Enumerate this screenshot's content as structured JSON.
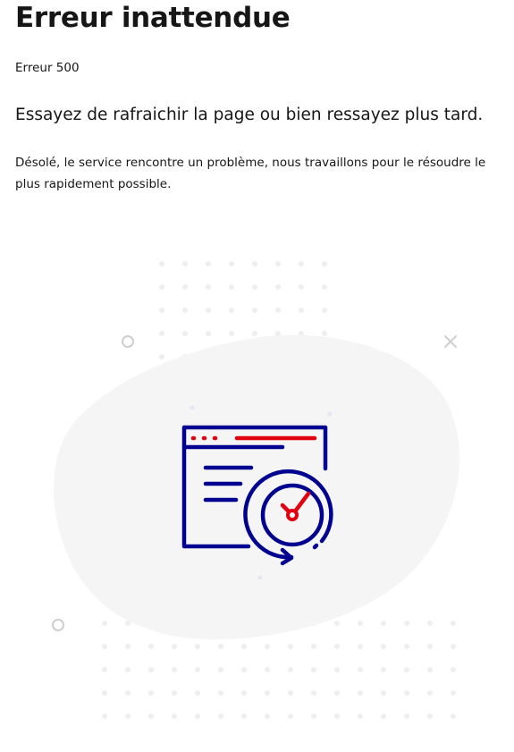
{
  "page": {
    "title": "Erreur inattendue",
    "error_code": "Erreur 500",
    "lead": "Essayez de rafraichir la page ou bien ressayez plus tard.",
    "description": "Désolé, le service rencontre un problème, nous travaillons pour le résoudre le plus rapidement possible."
  },
  "illustration": {
    "icon": "server-error-browser-clock-icon",
    "colors": {
      "primary_blue": "#000091",
      "accent_red": "#e1000f",
      "blob_gray": "#f5f5f5",
      "dot_gray": "#eeeeee",
      "ring_gray": "#cecece"
    }
  }
}
